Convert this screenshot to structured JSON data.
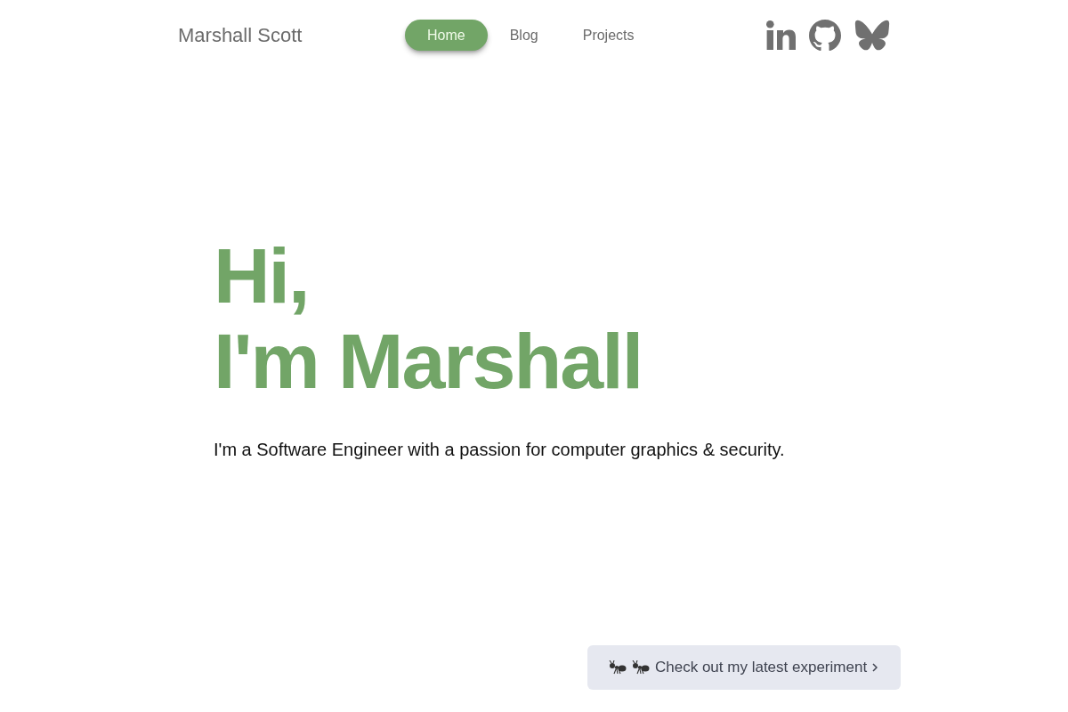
{
  "header": {
    "brand": "Marshall Scott",
    "nav": [
      {
        "label": "Home",
        "selected": true
      },
      {
        "label": "Blog",
        "selected": false
      },
      {
        "label": "Projects",
        "selected": false
      }
    ]
  },
  "hero": {
    "heading_lines": [
      "Hi,",
      "I'm Marshall"
    ],
    "tagline": "I'm a Software Engineer with a passion for computer graphics & security."
  },
  "callout": {
    "label": "Check out my latest experiment"
  }
}
